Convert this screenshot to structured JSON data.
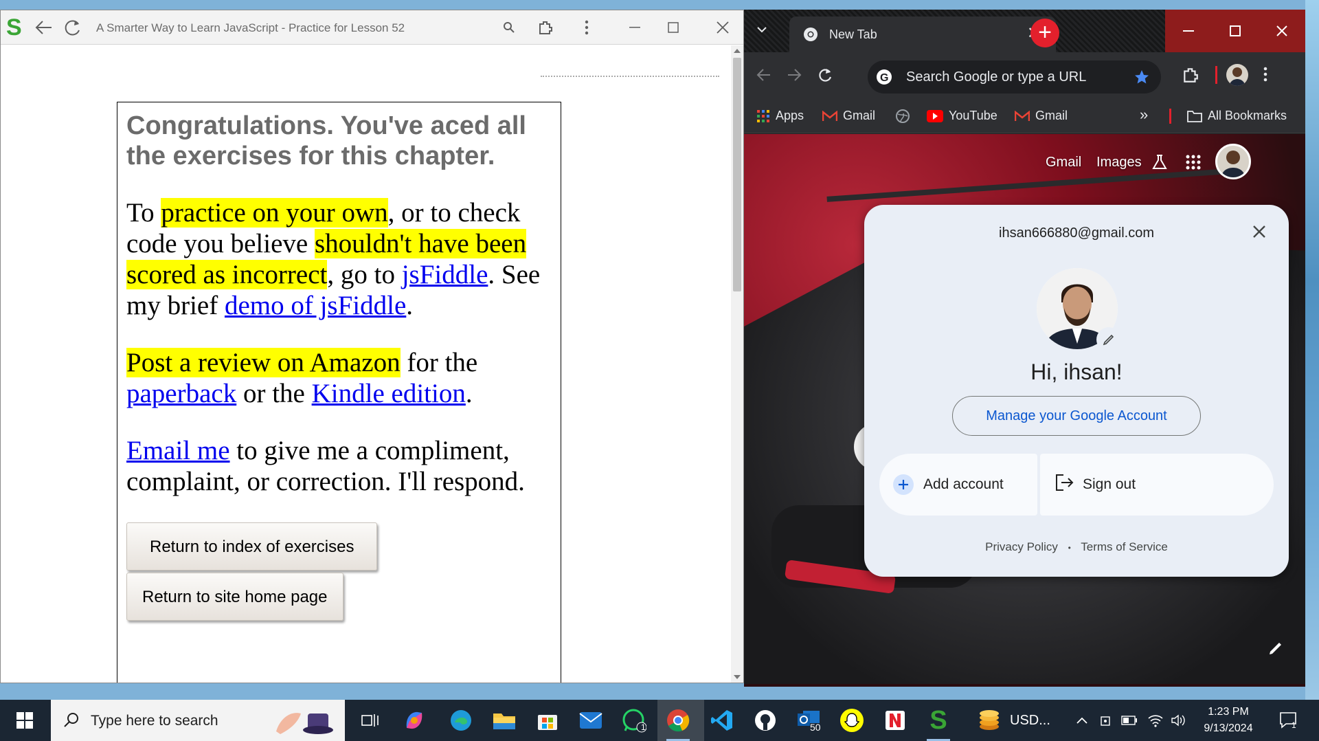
{
  "left_window": {
    "logo": "S",
    "title": "A Smarter Way to Learn JavaScript - Practice for Lesson 52",
    "heading": "Congratulations. You've aced all the exercises for this chapter.",
    "para1": {
      "t1": "To ",
      "h1": "practice on your own",
      "t2": ", or to check code you believe ",
      "h2": "shouldn't have been scored as incorrect",
      "t3": ", go to ",
      "l1": "jsFiddle",
      "t4": ". See my brief ",
      "l2": "demo of jsFiddle",
      "t5": "."
    },
    "para2": {
      "h1": "Post a review on Amazon",
      "t1": " for the ",
      "l1": "paperback",
      "t2": " or the ",
      "l2": "Kindle edition",
      "t3": "."
    },
    "para3": {
      "l1": "Email me",
      "t1": " to give me a compliment, complaint, or correction. I'll respond."
    },
    "button_index": "Return to index of exercises",
    "button_home": "Return to site home page"
  },
  "chrome": {
    "tab_title": "New Tab",
    "omnibox_placeholder": "Search Google or type a URL",
    "bookmarks": [
      "Apps",
      "Gmail",
      "YouTube",
      "Gmail"
    ],
    "all_bookmarks": "All Bookmarks",
    "more_bookmarks": "»",
    "ntp_links": [
      "Gmail",
      "Images"
    ]
  },
  "account_popup": {
    "email": "ihsan666880@gmail.com",
    "greeting": "Hi, ihsan!",
    "manage": "Manage your Google Account",
    "add_account": "Add account",
    "sign_out": "Sign out",
    "privacy": "Privacy Policy",
    "separator": "•",
    "terms": "Terms of Service"
  },
  "taskbar": {
    "search_placeholder": "Type here to search",
    "badge_whatsapp": "1",
    "badge_outlook": "50",
    "usd_label": "USD...",
    "time": "1:23 PM",
    "date": "9/13/2024",
    "notification_count": "1"
  },
  "colors": {
    "highlight": "#ffff00",
    "link": "#0000ee",
    "chrome_accent": "#8e1c1c",
    "google_blue": "#0b57d0"
  }
}
